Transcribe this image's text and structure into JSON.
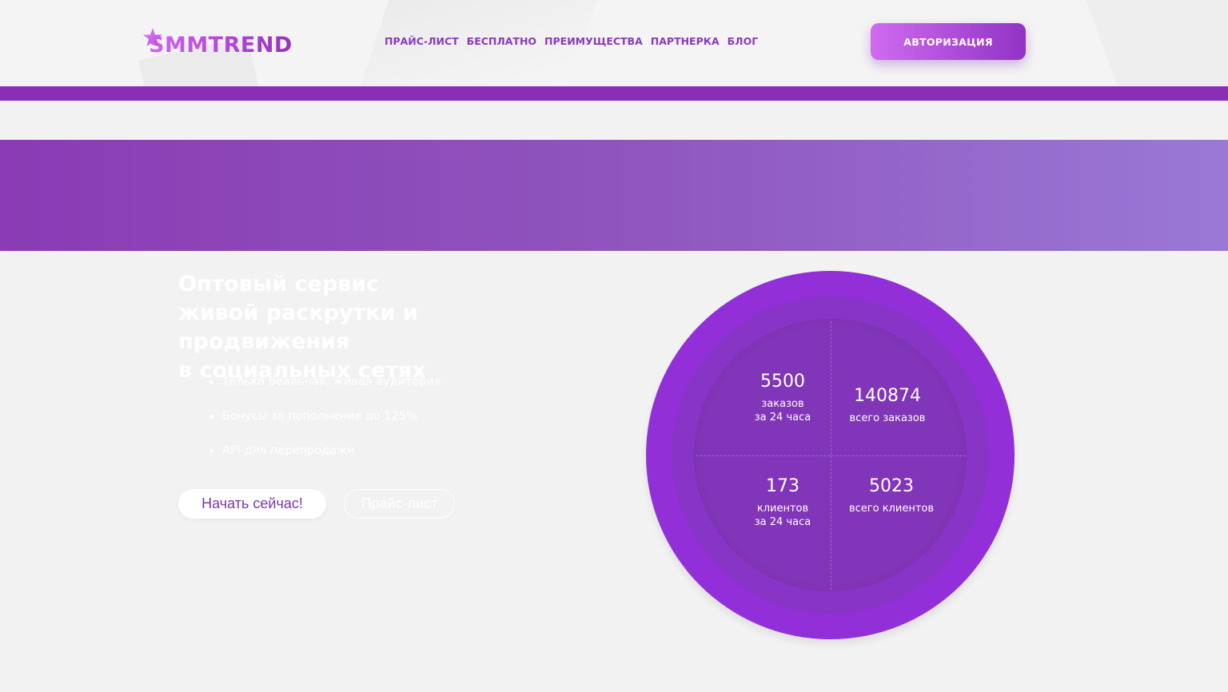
{
  "header": {
    "logo_text": "SMMTREND",
    "nav": [
      "ПРАЙС-ЛИСТ",
      "БЕСПЛАТНО",
      "ПРЕИМУЩЕСТВА",
      "ПАРТНЕРКА",
      "БЛОГ"
    ],
    "auth_label": "АВТОРИЗАЦИЯ"
  },
  "hero": {
    "title_bold": "Оптовый",
    "title_rest_1": " сервис",
    "title_line_2": "живой раскрутки и продвижения",
    "title_line_3": "в социальных сетях",
    "features": [
      "Только реальная, живая аудитория",
      "Бонусы за пополнение до 125%",
      "API для перепродажи"
    ],
    "start_label": "Начать сейчас!",
    "price_label": "Прайс-лист"
  },
  "stats": [
    {
      "value": "5500",
      "label": "заказов\nза 24 часа"
    },
    {
      "value": "140874",
      "label": "всего заказов"
    },
    {
      "value": "173",
      "label": "клиентов\nза 24 часа"
    },
    {
      "value": "5023",
      "label": "всего клиентов"
    }
  ],
  "colors": {
    "brand": "#8a2eb8",
    "circle": "#922fd9",
    "nav": "#8a3ab9"
  },
  "icons": {
    "logo": "star-icon"
  }
}
